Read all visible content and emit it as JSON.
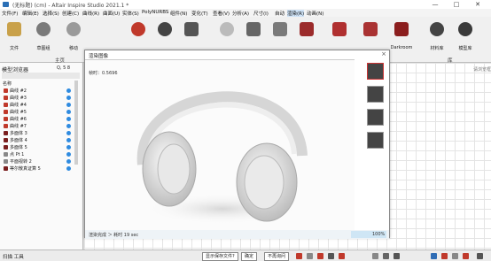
{
  "window": {
    "title": "(无标题) (cm) - Altair Inspire Studio 2021.1 *",
    "controls": [
      "—",
      "□",
      "✕"
    ]
  },
  "menubar": {
    "items": [
      "文件(F)",
      "编辑(E)",
      "选择(S)",
      "创建(C)",
      "曲线(R)",
      "曲面(U)",
      "实体(S)",
      "PolyNURBS",
      "组件(N)",
      "变化(T)",
      "查看(V)",
      "分析(A)",
      "尺寸(I)",
      "自动",
      "渲染(R)",
      "动画(N)"
    ]
  },
  "ribbon": {
    "tools": [
      {
        "label": "文件",
        "icon": "file-icon",
        "color": "#c9a14a"
      },
      {
        "label": "草图组",
        "icon": "sketch-icon",
        "color": "#7a7a7a"
      },
      {
        "label": "移动",
        "icon": "move-icon",
        "color": "#8a8a8a"
      },
      {
        "label": "",
        "icon": "sphere-icon",
        "color": "#c0392b"
      },
      {
        "label": "",
        "icon": "material-icon",
        "color": "#444444"
      },
      {
        "label": "",
        "icon": "shape-icon",
        "color": "#555555"
      },
      {
        "label": "",
        "icon": "light-icon",
        "color": "#bbbbbb"
      },
      {
        "label": "",
        "icon": "camera-icon",
        "color": "#666666"
      },
      {
        "label": "",
        "icon": "environment-icon",
        "color": "#7a7a7a"
      },
      {
        "label": "",
        "icon": "render-icon",
        "color": "#9b2b2b"
      },
      {
        "label": "",
        "icon": "image-icon",
        "color": "#b03030"
      },
      {
        "label": "",
        "icon": "output-icon",
        "color": "#a33"
      },
      {
        "label": "Darkroom",
        "icon": "darkroom-icon",
        "color": "#8b1e1e"
      },
      {
        "label": "材料库",
        "icon": "material-library-icon",
        "color": "#444444"
      },
      {
        "label": "模型库",
        "icon": "model-library-icon",
        "color": "#3a3a3a"
      }
    ],
    "section_home": "主页",
    "section_library": "库"
  },
  "left_panel": {
    "title": "模型浏览器",
    "search_label": "Q, 5 8",
    "header": "名称",
    "items": [
      {
        "label": "曲线 #2",
        "color": "#c0392b"
      },
      {
        "label": "曲线 #3",
        "color": "#c0392b"
      },
      {
        "label": "曲线 #4",
        "color": "#c0392b"
      },
      {
        "label": "曲线 #5",
        "color": "#c0392b"
      },
      {
        "label": "曲线 #6",
        "color": "#c0392b"
      },
      {
        "label": "曲线 #7",
        "color": "#c0392b"
      },
      {
        "label": "多面体 3",
        "color": "#7a1e1e"
      },
      {
        "label": "多面体 4",
        "color": "#7a1e1e"
      },
      {
        "label": "多面体 5",
        "color": "#7a1e1e"
      },
      {
        "label": "点 Pt 1",
        "color": "#888888"
      },
      {
        "label": "平面视转 2",
        "color": "#888888"
      },
      {
        "label": "等尔散真证算 5",
        "color": "#7a1e1e"
      }
    ]
  },
  "render_dialog": {
    "title": "渲染图像",
    "progress_label": "帧时：0.5696",
    "status_text": "渲染完成 ＞ 耗时 19 sec",
    "percent": "100%",
    "percent_value": 100
  },
  "bottom_bar": {
    "left_label": "扫描 工具",
    "buttons": [
      "显示保存文件?",
      "确定",
      "不再询问"
    ]
  },
  "right_hint": "请浏览框"
}
